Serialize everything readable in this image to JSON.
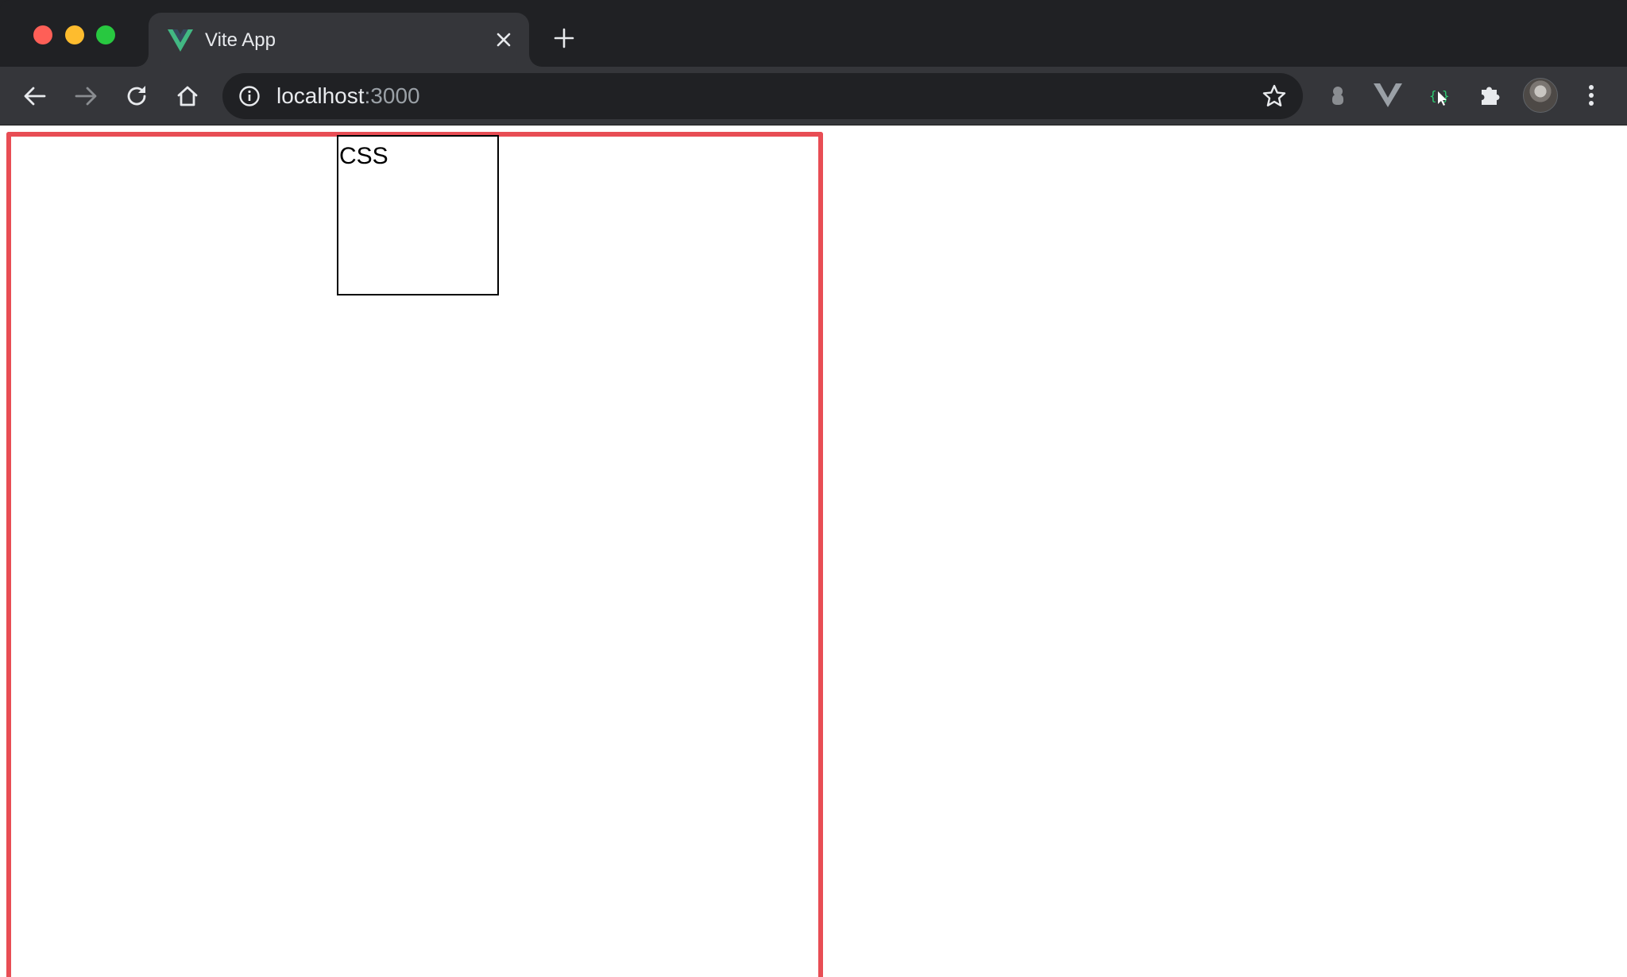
{
  "window": {
    "traffic_lights": [
      "close",
      "minimize",
      "maximize"
    ]
  },
  "tab": {
    "title": "Vite App",
    "favicon": "vue-logo-icon",
    "favicon_color": "#42b883"
  },
  "toolbar": {
    "buttons": [
      "back-icon",
      "forward-icon",
      "reload-icon",
      "home-icon"
    ],
    "url_host": "localhost",
    "url_port": ":3000",
    "extensions": [
      "extension-gray-icon",
      "vue-devtools-icon",
      "css-peeper-icon",
      "puzzle-icon"
    ],
    "menu_icon": "more-vert-icon"
  },
  "page": {
    "box_label": "CSS",
    "frame_color": "#e84d54"
  }
}
